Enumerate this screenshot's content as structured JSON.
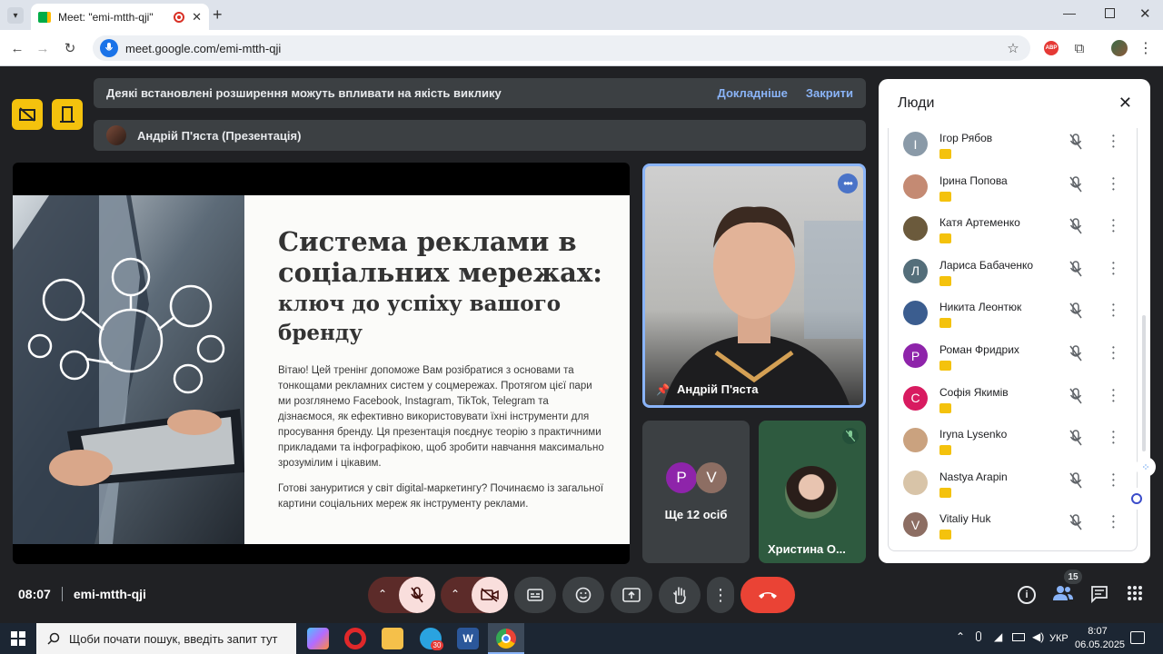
{
  "browser": {
    "tab_title": "Meet: \"emi-mtth-qji\"",
    "url": "meet.google.com/emi-mtth-qji"
  },
  "banner": {
    "message": "Деякі встановлені розширення можуть впливати на якість виклику",
    "learn_more": "Докладніше",
    "close": "Закрити"
  },
  "presenter_bar": {
    "label": "Андрій П'яста (Презентація)"
  },
  "slide": {
    "title_line1": "Система реклами в",
    "title_line2": "соціальних мережах:",
    "subtitle_line1": "ключ до успіху вашого",
    "subtitle_line2": "бренду",
    "para1": "Вітаю! Цей тренінг допоможе Вам розібратися з основами та тонкощами рекламних систем у соцмережах. Протягом цієї пари  ми розглянемо Facebook, Instagram, TikTok, Telegram та дізнаємося, як ефективно використовувати їхні інструменти для просування бренду. Ця презентація поєднує теорію з практичними прикладами та інфографікою, щоб зробити навчання максимально зрозумілим і цікавим.",
    "para2": "Готові зануритися у світ digital-маркетингу? Починаємо із загальної картини соціальних мереж як інструменту реклами."
  },
  "tiles": {
    "main_name": "Андрій П'яста",
    "more_p": "P",
    "more_v": "V",
    "more_label": "Ще 12 осіб",
    "khrystyna_name": "Христина О..."
  },
  "controls": {
    "time": "08:07",
    "meeting_code": "emi-mtth-qji",
    "people_count": "15"
  },
  "people_panel": {
    "title": "Люди",
    "participants": [
      {
        "name": "Ігор Рябов",
        "initial": "І",
        "color": "#8a9aa8"
      },
      {
        "name": "Ірина Попова",
        "initial": "",
        "color": "#c48a73"
      },
      {
        "name": "Катя Артеменко",
        "initial": "",
        "color": "#6b5a3c"
      },
      {
        "name": "Лариса Бабаченко",
        "initial": "Л",
        "color": "#546e7a"
      },
      {
        "name": "Никита Леонтюк",
        "initial": "",
        "color": "#3b5d8f"
      },
      {
        "name": "Роман Фридрих",
        "initial": "Р",
        "color": "#8e24aa"
      },
      {
        "name": "Софія Якимів",
        "initial": "С",
        "color": "#d81b60"
      },
      {
        "name": "Iryna Lysenko",
        "initial": "",
        "color": "#caa27f"
      },
      {
        "name": "Nastya Arapin",
        "initial": "",
        "color": "#d8c4a8"
      },
      {
        "name": "Vitaliy Huk",
        "initial": "V",
        "color": "#8d6e63"
      }
    ]
  },
  "taskbar": {
    "search_placeholder": "Щоби почати пошук, введіть запит тут",
    "lang": "УКР",
    "clock_time": "8:07",
    "clock_date": "06.05.2025",
    "telegram_badge": "30"
  }
}
